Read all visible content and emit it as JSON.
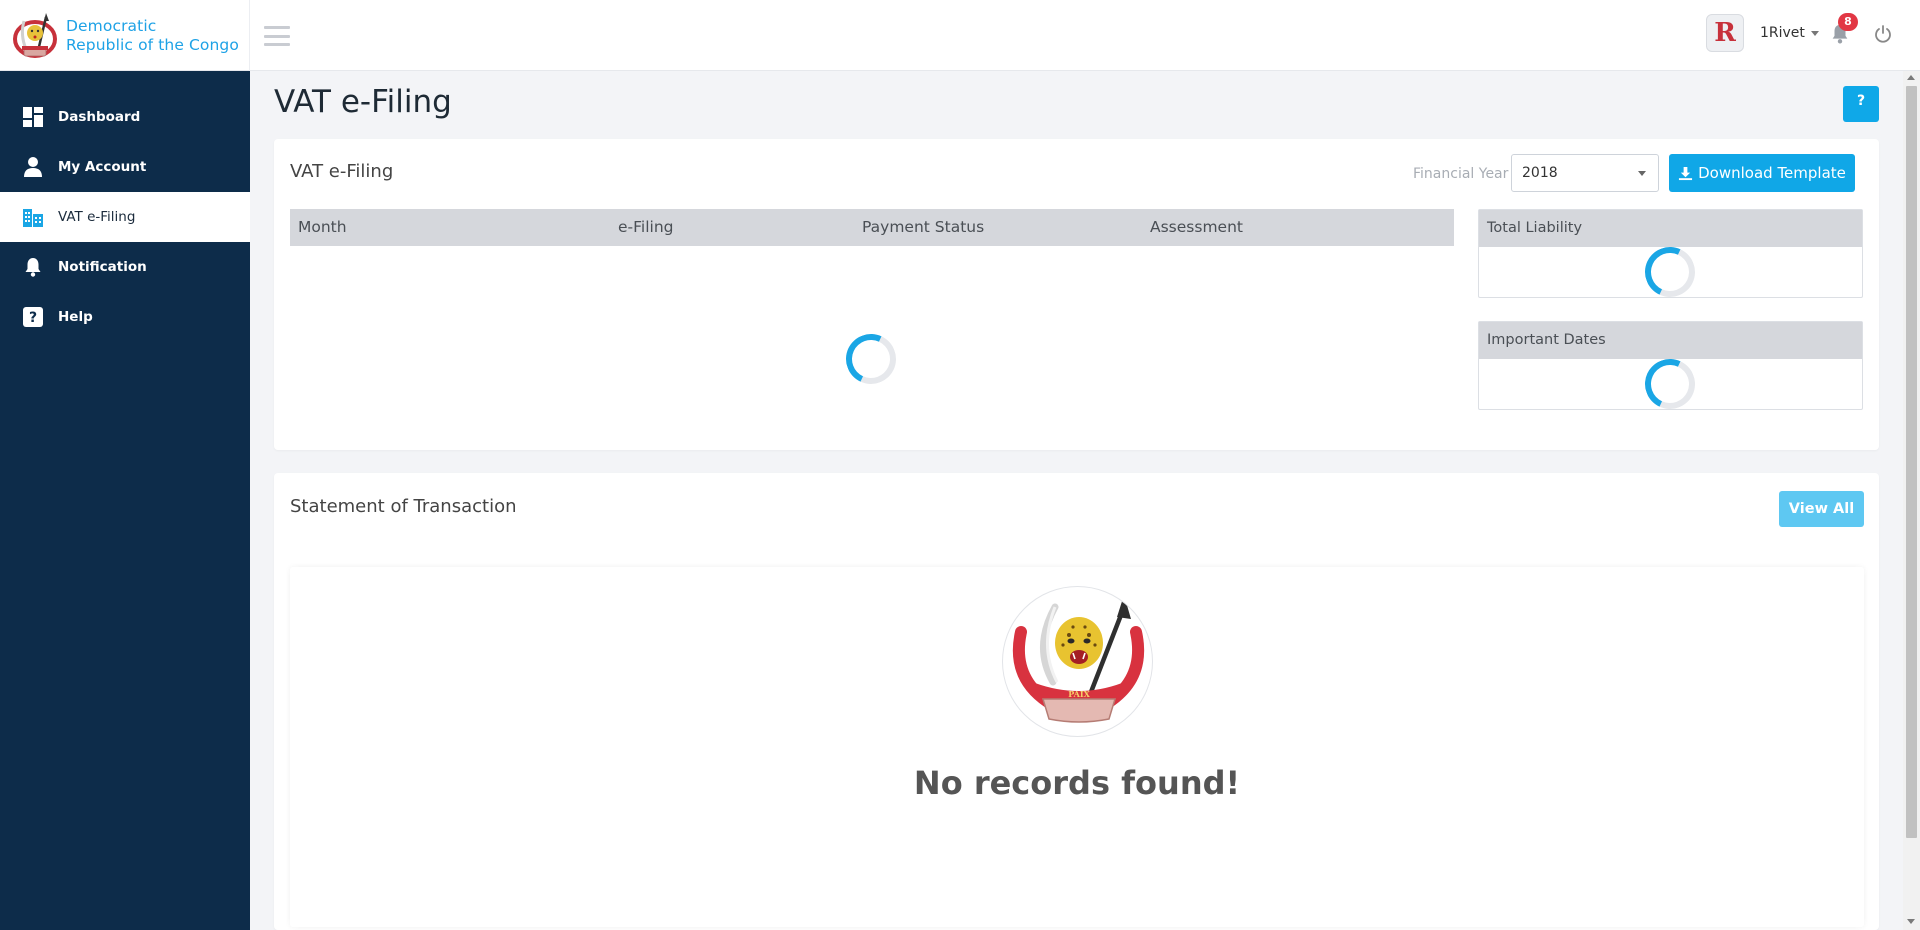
{
  "brand": {
    "name_line1": "Democratic",
    "name_line2": "Republic of the Congo",
    "color": "#1ea2e6"
  },
  "header": {
    "avatar_letter": "R",
    "username": "1Rivet",
    "notification_count": "8",
    "icons": [
      "menu-icon",
      "bell-icon",
      "power-icon"
    ]
  },
  "sidebar": {
    "background": "#0d2c4a",
    "items": [
      {
        "label": "Dashboard",
        "icon": "dashboard-icon",
        "active": false
      },
      {
        "label": "My Account",
        "icon": "user-icon",
        "active": false
      },
      {
        "label": "VAT e-Filing",
        "icon": "building-icon",
        "active": true
      },
      {
        "label": "Notification",
        "icon": "bell-icon",
        "active": false
      },
      {
        "label": "Help",
        "icon": "question-icon",
        "active": false
      }
    ]
  },
  "page": {
    "title": "VAT e-Filing",
    "help_label": "?"
  },
  "vat_card": {
    "title": "VAT e-Filing",
    "financial_year_label": "Financial Year",
    "financial_year_value": "2018",
    "download_label": "Download Template",
    "table_headers": [
      "Month",
      "e-Filing",
      "Payment Status",
      "Assessment"
    ],
    "total_liability_label": "Total Liability",
    "important_dates_label": "Important Dates"
  },
  "statement_card": {
    "title": "Statement of Transaction",
    "view_all_label": "View All",
    "empty_message": "No records found!",
    "emblem_motto": "PAIX"
  },
  "colors": {
    "accent": "#10a7e7",
    "badge": "#e23744"
  }
}
